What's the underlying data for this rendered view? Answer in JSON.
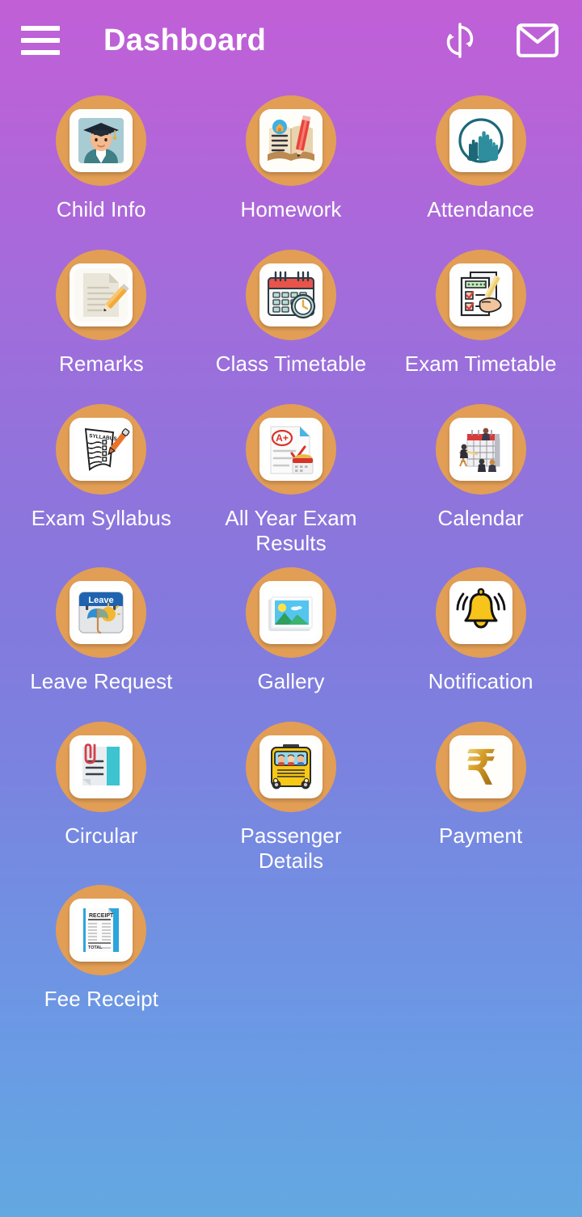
{
  "header": {
    "menu_icon": "hamburger-menu-icon",
    "title": "Dashboard",
    "actions": [
      {
        "icon": "sync-refresh-icon",
        "name": "refresh-button"
      },
      {
        "icon": "envelope-mail-icon",
        "name": "mail-button"
      }
    ]
  },
  "theme": {
    "gradient_top": "#c05fd6",
    "gradient_bottom": "#63a8e0",
    "circle_color": "#e29e55",
    "tile_bg": "#fdfdfb",
    "label_color": "#ffffff"
  },
  "tiles": [
    {
      "label": "Child Info",
      "icon": "graduate-student-photo-icon"
    },
    {
      "label": "Homework",
      "icon": "open-book-pencil-icon"
    },
    {
      "label": "Attendance",
      "icon": "raised-hands-circle-icon"
    },
    {
      "label": "Remarks",
      "icon": "document-pencil-icon"
    },
    {
      "label": "Class Timetable",
      "icon": "calendar-clock-icon"
    },
    {
      "label": "Exam Timetable",
      "icon": "checklist-hand-pen-icon"
    },
    {
      "label": "Exam Syllabus",
      "icon": "syllabus-sheet-pen-icon"
    },
    {
      "label": "All Year Exam Results",
      "icon": "a-plus-result-sheet-icon"
    },
    {
      "label": "Calendar",
      "icon": "wall-calendar-people-icon"
    },
    {
      "label": "Leave Request",
      "icon": "leave-calendar-umbrella-icon"
    },
    {
      "label": "Gallery",
      "icon": "landscape-photo-icon"
    },
    {
      "label": "Notification",
      "icon": "ringing-bell-icon"
    },
    {
      "label": "Circular",
      "icon": "paperclip-documents-icon"
    },
    {
      "label": "Passenger Details",
      "icon": "school-bus-icon"
    },
    {
      "label": "Payment",
      "icon": "rupee-symbol-icon"
    },
    {
      "label": "Fee Receipt",
      "icon": "receipt-document-icon"
    }
  ]
}
